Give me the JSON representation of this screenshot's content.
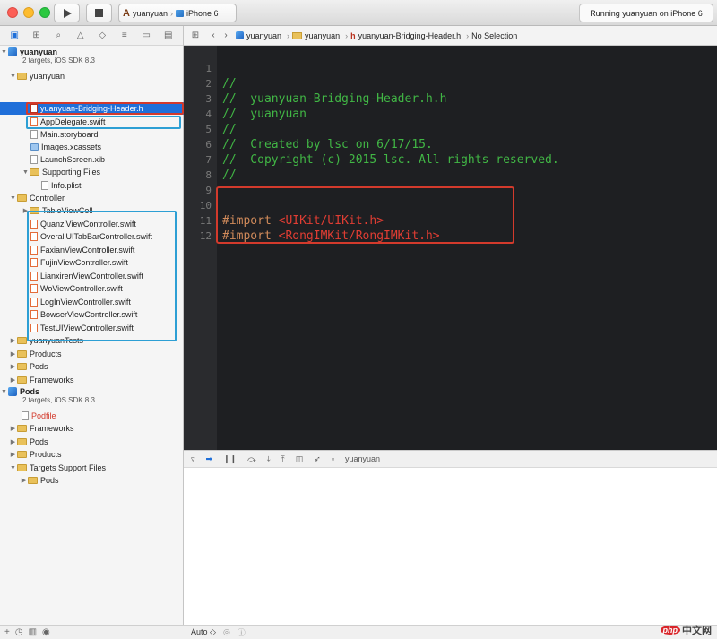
{
  "toolbar": {
    "scheme_name": "yuanyuan",
    "scheme_device": "iPhone 6",
    "status": "Running yuanyuan on iPhone 6"
  },
  "navigator": {
    "project": {
      "name": "yuanyuan",
      "subtitle": "2 targets, iOS SDK 8.3"
    },
    "group_main": "yuanyuan",
    "files": {
      "bridging": "yuanyuan-Bridging-Header.h",
      "appdelegate": "AppDelegate.swift",
      "storyboard": "Main.storyboard",
      "xcassets": "Images.xcassets",
      "launch": "LaunchScreen.xib",
      "supporting": "Supporting Files",
      "infoplist": "Info.plist"
    },
    "controller_group": "Controller",
    "tableviewcell": "TableViewCell",
    "controllers": [
      "QuanziViewController.swift",
      "OverallUITabBarController.swift",
      "FaxianViewController.swift",
      "FujinViewController.swift",
      "LianxirenViewController.swift",
      "WoViewController.swift",
      "LogInViewController.swift",
      "BowserViewController.swift",
      "TestUIViewController.swift"
    ],
    "tests_group": "yuanyuanTests",
    "products": "Products",
    "pods_group": "Pods",
    "frameworks": "Frameworks",
    "pods_project": {
      "name": "Pods",
      "subtitle": "2 targets, iOS SDK 8.3"
    },
    "podfile": "Podfile",
    "pods_frameworks": "Frameworks",
    "pods_pods": "Pods",
    "pods_products": "Products",
    "targets_support": "Targets Support Files",
    "targets_pods": "Pods"
  },
  "jumpbar": {
    "crumb1": "yuanyuan",
    "crumb2": "yuanyuan",
    "crumb3": "yuanyuan-Bridging-Header.h",
    "crumb4": "No Selection"
  },
  "code": {
    "numbers": [
      "1",
      "2",
      "3",
      "4",
      "5",
      "6",
      "7",
      "8",
      "9",
      "10",
      "11",
      "12"
    ],
    "l2": "//",
    "l3": "//  yuanyuan-Bridging-Header.h.h",
    "l4": "//  yuanyuan",
    "l5": "//",
    "l6": "//  Created by lsc on 6/17/15.",
    "l7": "//  Copyright (c) 2015 lsc. All rights reserved.",
    "l8": "//",
    "import": "#import",
    "l11_path": "<UIKit/UIKit.h>",
    "l12_path": "<RongIMKit/RongIMKit.h>"
  },
  "debug": {
    "target": "yuanyuan"
  },
  "console": {
    "mode": "Auto ◇"
  },
  "watermark": {
    "php": "php",
    "cn": "中文网"
  },
  "colors": {
    "selection": "#1f6fd9",
    "highlight_red": "#d33a2c",
    "highlight_blue": "#2d9fd4",
    "comment": "#41b645",
    "string": "#e03d33"
  }
}
